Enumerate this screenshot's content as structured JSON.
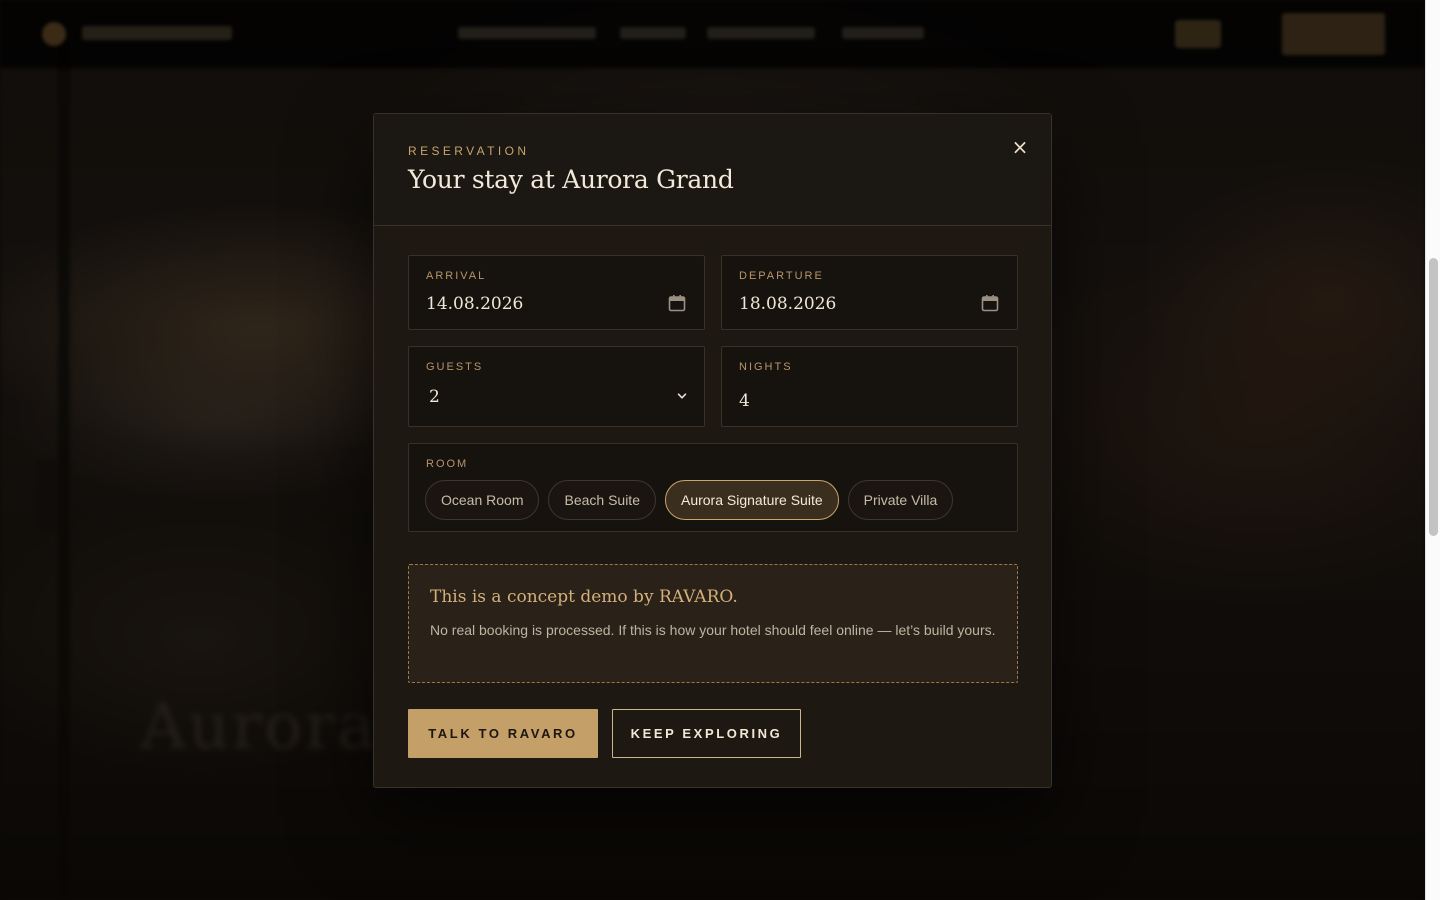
{
  "modal": {
    "eyebrow": "RESERVATION",
    "title": "Your stay at Aurora Grand",
    "close_glyph": "×"
  },
  "form": {
    "arrival": {
      "label": "ARRIVAL",
      "value": "14.08.2026",
      "icon": "calendar-icon"
    },
    "departure": {
      "label": "DEPARTURE",
      "value": "18.08.2026",
      "icon": "calendar-icon"
    },
    "guests": {
      "label": "GUESTS",
      "value": "2",
      "icon": "chevron-down-icon"
    },
    "nights": {
      "label": "NIGHTS",
      "value": "4"
    },
    "room": {
      "label": "ROOM",
      "options": [
        "Ocean Room",
        "Beach Suite",
        "Aurora Signature Suite",
        "Private Villa"
      ],
      "selected": "Aurora Signature Suite"
    }
  },
  "notice": {
    "title": "This is a concept demo by RAVARO.",
    "body": "No real booking is processed. If this is how your hotel should feel online — let’s build yours."
  },
  "actions": {
    "primary_label": "TALK TO RAVARO",
    "secondary_label": "KEEP EXPLORING"
  },
  "background": {
    "watermark": "Aurora"
  },
  "colors": {
    "accent": "#c49f68",
    "modal_bg": "#1d1812",
    "field_bg": "#16120e",
    "border": "#3a3126",
    "label": "#b9956a"
  }
}
